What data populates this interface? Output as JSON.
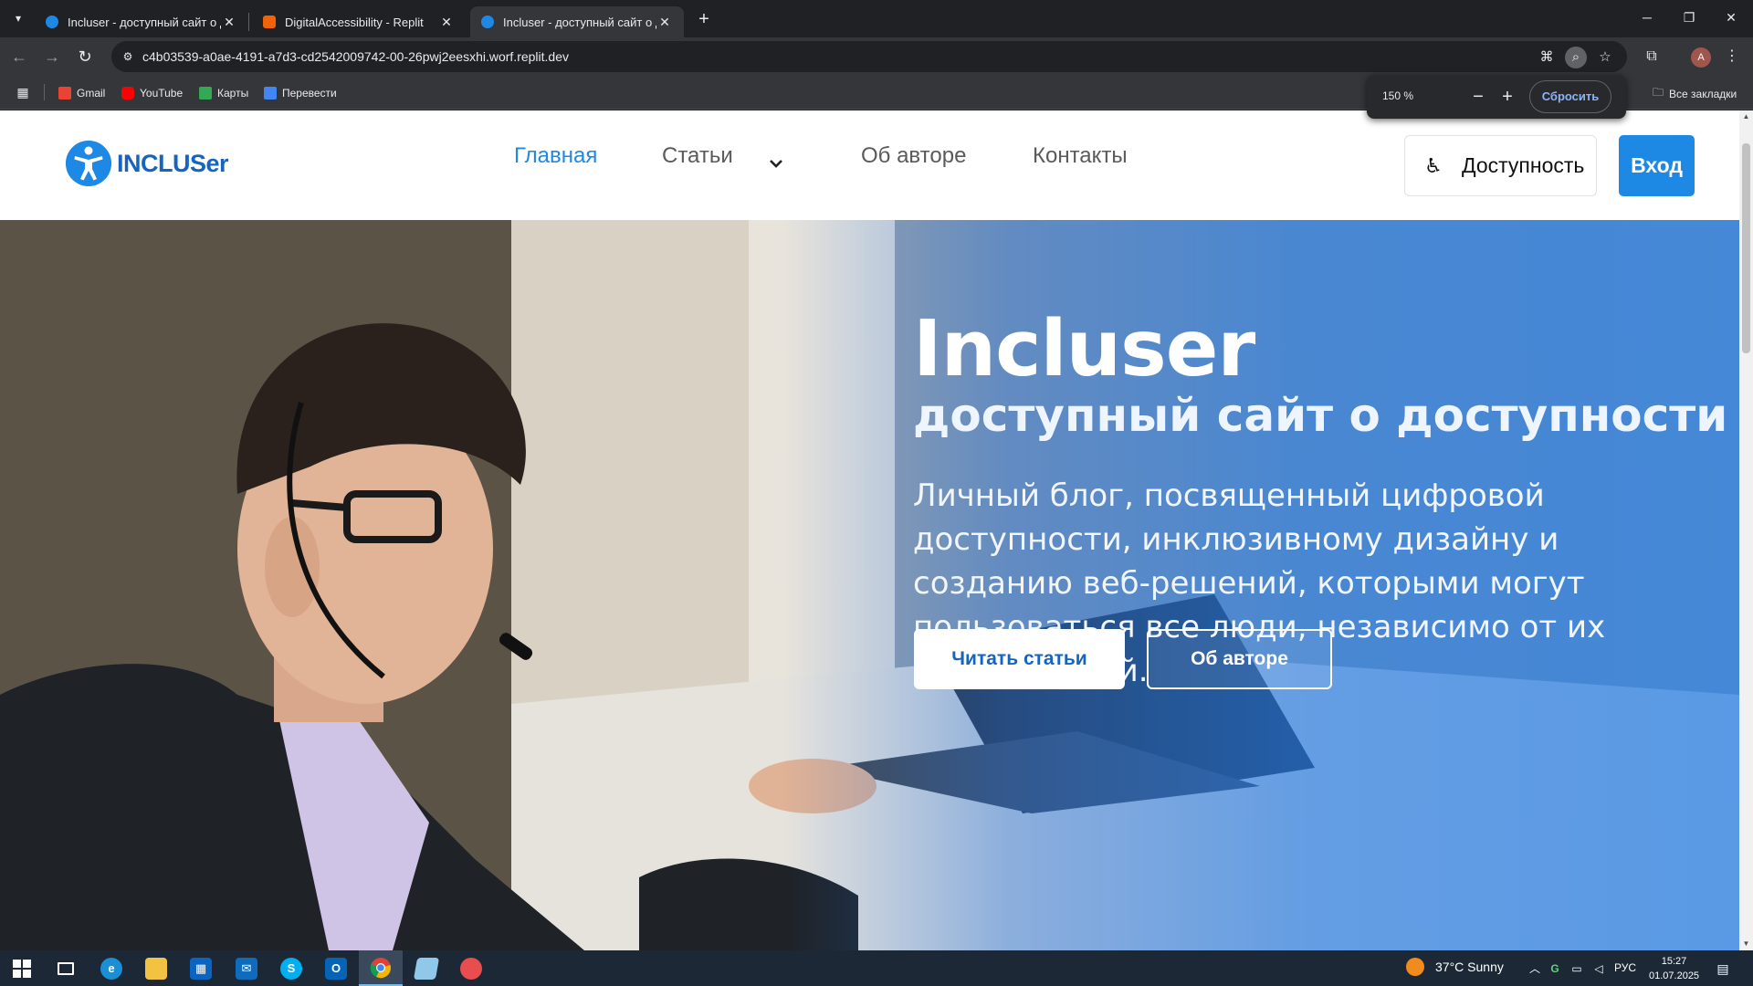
{
  "browser": {
    "tabs": [
      {
        "title": "Incluser - доступный сайт о до",
        "active": false
      },
      {
        "title": "DigitalAccessibility - Replit",
        "active": false
      },
      {
        "title": "Incluser - доступный сайт о до",
        "active": true
      }
    ],
    "url": "c4b03539-a0ae-4191-a7d3-cd2542009742-00-26pwj2eesxhi.worf.replit.dev",
    "bookmarks": [
      "Gmail",
      "YouTube",
      "Карты",
      "Перевести"
    ],
    "all_bookmarks": "Все закладки",
    "profile_initial": "A",
    "zoom": {
      "level": "150 %",
      "reset": "Сбросить"
    }
  },
  "site": {
    "logo": "INCLUSer",
    "nav": [
      {
        "label": "Главная",
        "active": true
      },
      {
        "label": "Статьи",
        "active": false
      },
      {
        "label": "Об авторе",
        "active": false
      },
      {
        "label": "Контакты",
        "active": false
      }
    ],
    "accessibility_button": "Доступность",
    "login_button": "Вход",
    "accent_color": "#1e88e5"
  },
  "hero": {
    "title": "Incluser",
    "subtitle": "доступный сайт о доступности",
    "description": "Личный блог, посвященный цифровой доступности, инклюзивному дизайну и созданию веб-решений, которыми могут пользоваться все люди, независимо от их способностей.",
    "primary_button": "Читать статьи",
    "secondary_button": "Об авторе"
  },
  "taskbar": {
    "weather": "37°C  Sunny",
    "language": "РУС",
    "time": "15:27",
    "date": "01.07.2025"
  }
}
